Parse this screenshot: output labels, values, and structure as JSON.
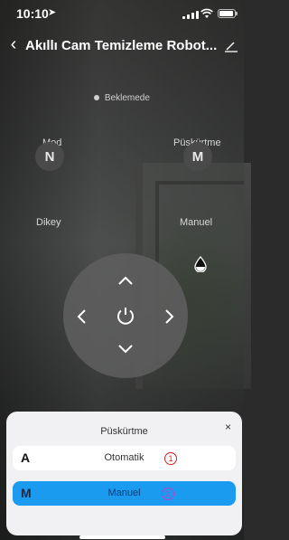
{
  "status_bar": {
    "time": "10:10"
  },
  "nav": {
    "title": "Akıllı Cam Temizleme Robot..."
  },
  "device_state": {
    "label": "Beklemede"
  },
  "mode": {
    "label": "Mod",
    "icon_letter": "N",
    "value": "Dikey"
  },
  "spray": {
    "label": "Püskürtme",
    "icon_letter": "M",
    "value": "Manuel"
  },
  "sheet": {
    "title": "Püskürtme",
    "close": "×",
    "options": [
      {
        "letter": "A",
        "label": "Otomatik",
        "badge": "1",
        "selected": false
      },
      {
        "letter": "M",
        "label": "Manuel",
        "badge": "2",
        "selected": true
      }
    ]
  },
  "colors": {
    "accent": "#1a9bf0",
    "badge_red": "#d02020",
    "badge_purple": "#c23fd0"
  }
}
